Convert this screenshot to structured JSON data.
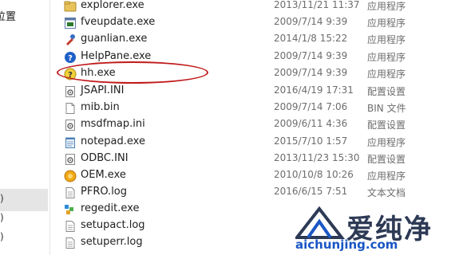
{
  "nav": {
    "label": "位置",
    "items": [
      ")",
      ")",
      ")"
    ]
  },
  "files": [
    {
      "name": "explorer.exe",
      "date": "2013/11/21 11:37",
      "type": "应用程序",
      "icon": "explorer-icon"
    },
    {
      "name": "fveupdate.exe",
      "date": "2009/7/14 9:39",
      "type": "应用程序",
      "icon": "exe-app-icon"
    },
    {
      "name": "guanlian.exe",
      "date": "2014/1/8 15:22",
      "type": "应用程序",
      "icon": "tool-icon"
    },
    {
      "name": "HelpPane.exe",
      "date": "2009/7/14 9:39",
      "type": "应用程序",
      "icon": "help-icon"
    },
    {
      "name": "hh.exe",
      "date": "2009/7/14 9:39",
      "type": "应用程序",
      "icon": "help-question-icon"
    },
    {
      "name": "JSAPI.INI",
      "date": "2016/4/19 17:31",
      "type": "配置设置",
      "icon": "ini-config-icon"
    },
    {
      "name": "mib.bin",
      "date": "2009/7/14 7:06",
      "type": "BIN 文件",
      "icon": "file-icon"
    },
    {
      "name": "msdfmap.ini",
      "date": "2009/6/11 4:36",
      "type": "配置设置",
      "icon": "ini-config-icon"
    },
    {
      "name": "notepad.exe",
      "date": "2015/7/10 1:57",
      "type": "应用程序",
      "icon": "notepad-icon"
    },
    {
      "name": "ODBC.INI",
      "date": "2013/11/23 15:30",
      "type": "配置设置",
      "icon": "ini-config-icon"
    },
    {
      "name": "OEM.exe",
      "date": "2010/10/8 10:26",
      "type": "应用程序",
      "icon": "oem-icon"
    },
    {
      "name": "PFRO.log",
      "date": "2016/6/15 7:51",
      "type": "文本文档",
      "icon": "text-document-icon"
    },
    {
      "name": "regedit.exe",
      "date": "",
      "type": "",
      "icon": "regedit-icon"
    },
    {
      "name": "setupact.log",
      "date": "",
      "type": "",
      "icon": "text-document-icon"
    },
    {
      "name": "setuperr.log",
      "date": "",
      "type": "",
      "icon": "text-document-icon"
    }
  ],
  "watermark": {
    "brand": "爱纯净",
    "url": "aichunjing.com"
  },
  "colors": {
    "highlight_ellipse": "#c01a1a",
    "watermark_brand": "#2d3a55",
    "watermark_url": "#1a56c5",
    "nav_selected": "#e5e5e5"
  }
}
